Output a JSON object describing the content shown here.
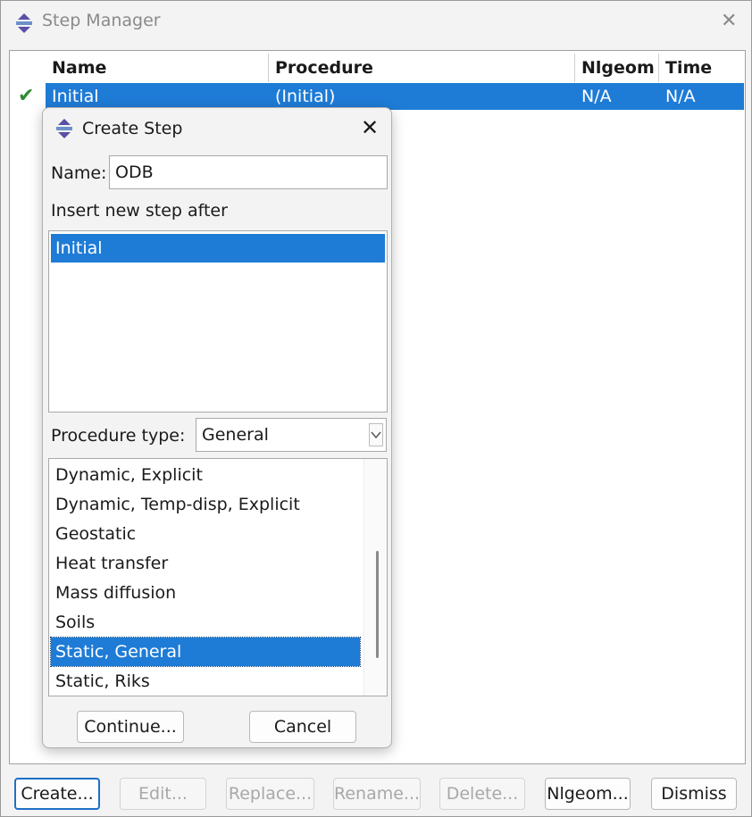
{
  "window": {
    "title": "Step Manager",
    "close": "✕"
  },
  "table": {
    "columns": [
      "Name",
      "Procedure",
      "Nlgeom",
      "Time"
    ],
    "rows": [
      {
        "status": "✔",
        "name": "Initial",
        "procedure": "(Initial)",
        "nlgeom": "N/A",
        "time": "N/A",
        "selected": true
      }
    ]
  },
  "buttons": {
    "create": "Create...",
    "edit": "Edit...",
    "replace": "Replace...",
    "rename": "Rename...",
    "delete": "Delete...",
    "nlgeom": "Nlgeom...",
    "dismiss": "Dismiss"
  },
  "dialog": {
    "title": "Create Step",
    "close": "✕",
    "name_label": "Name:",
    "name_value": "ODB",
    "insert_label": "Insert new step after",
    "insert_items": [
      "Initial"
    ],
    "procedure_label": "Procedure type:",
    "procedure_value": "General",
    "procedure_items": [
      "Dynamic, Explicit",
      "Dynamic, Temp-disp, Explicit",
      "Geostatic",
      "Heat transfer",
      "Mass diffusion",
      "Soils",
      "Static, General",
      "Static, Riks"
    ],
    "procedure_selected": "Static, General",
    "continue": "Continue...",
    "cancel": "Cancel"
  },
  "colors": {
    "selection": "#1e7bd6",
    "check": "#2e8b2e",
    "icon_purple": "#5a4fa8"
  },
  "icons": {
    "app": "abaqus-step-icon",
    "check": "checkmark-icon",
    "chevron": "chevron-down-icon"
  }
}
